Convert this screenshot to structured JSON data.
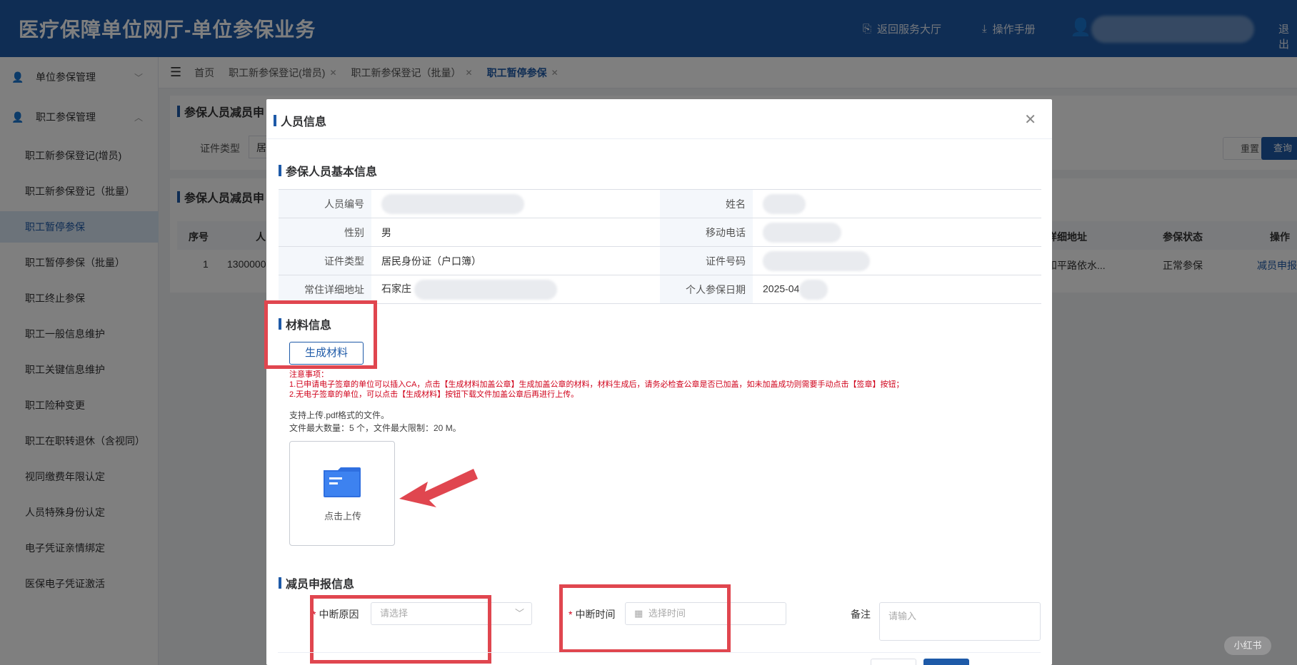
{
  "header": {
    "title": "医疗保障单位网厅-单位参保业务",
    "back_label": "返回服务大厅",
    "manual_label": "操作手册",
    "logout_label": "退出"
  },
  "sidebar": {
    "groups": [
      {
        "label": "单位参保管理",
        "icon": "user-icon"
      },
      {
        "label": "职工参保管理",
        "icon": "user-icon"
      }
    ],
    "items": [
      "职工新参保登记(增员)",
      "职工新参保登记（批量）",
      "职工暂停参保",
      "职工暂停参保（批量）",
      "职工终止参保",
      "职工一般信息维护",
      "职工关键信息维护",
      "职工险种变更",
      "职工在职转退休（含视同）",
      "视同缴费年限认定",
      "人员特殊身份认定",
      "电子凭证亲情绑定",
      "医保电子凭证激活"
    ],
    "active_index": 2
  },
  "tabs": [
    {
      "label": "首页",
      "closable": false
    },
    {
      "label": "职工新参保登记(增员)",
      "closable": true
    },
    {
      "label": "职工新参保登记（批量）",
      "closable": true
    },
    {
      "label": "职工暂停参保",
      "closable": true,
      "active": true
    }
  ],
  "background": {
    "search_section_title": "参保人员减员申",
    "id_type_label": "证件类型",
    "id_type_value_partial": "居",
    "reset_label": "重置",
    "query_label": "查询",
    "list_section_title": "参保人员减员申",
    "columns": [
      "序号",
      "人",
      "详细地址",
      "参保状态",
      "操作"
    ],
    "row": {
      "index": "1",
      "id_partial": "1300000",
      "address_partial": "和平路依水...",
      "status": "正常参保",
      "action": "减员申报"
    }
  },
  "modal": {
    "title": "人员信息",
    "basic_section": "参保人员基本信息",
    "fields": {
      "person_no_label": "人员编号",
      "name_label": "姓名",
      "gender_label": "性别",
      "gender_value": "男",
      "phone_label": "移动电话",
      "id_type_label": "证件类型",
      "id_type_value": "居民身份证（户口簿）",
      "id_no_label": "证件号码",
      "address_label": "常住详细地址",
      "address_value": "石家庄",
      "insured_date_label": "个人参保日期",
      "insured_date_value": "2025-04"
    },
    "material_section": "材料信息",
    "generate_button": "生成材料",
    "notice_title": "注意事项：",
    "notice_1": "1.已申请电子签章的单位可以插入CA，点击【生成材料加盖公章】生成加盖公章的材料，材料生成后，请务必检查公章是否已加盖，如未加盖成功则需要手动点击【签章】按钮；",
    "notice_2": "2.无电子签章的单位，可以点击【生成材料】按钮下载文件加盖公章后再进行上传。",
    "support_1": "支持上传.pdf格式的文件。",
    "support_2": "文件最大数量：5 个，文件最大限制：20 M。",
    "upload_label": "点击上传",
    "reduce_section": "减员申报信息",
    "reason_label": "中断原因",
    "reason_placeholder": "请选择",
    "time_label": "中断时间",
    "time_placeholder": "选择时间",
    "remark_label": "备注",
    "remark_placeholder": "请输入"
  },
  "watermark_badge": "小红书",
  "colors": {
    "primary": "#1e5aa8",
    "highlight": "#e0464f",
    "notice": "#d0021b"
  }
}
